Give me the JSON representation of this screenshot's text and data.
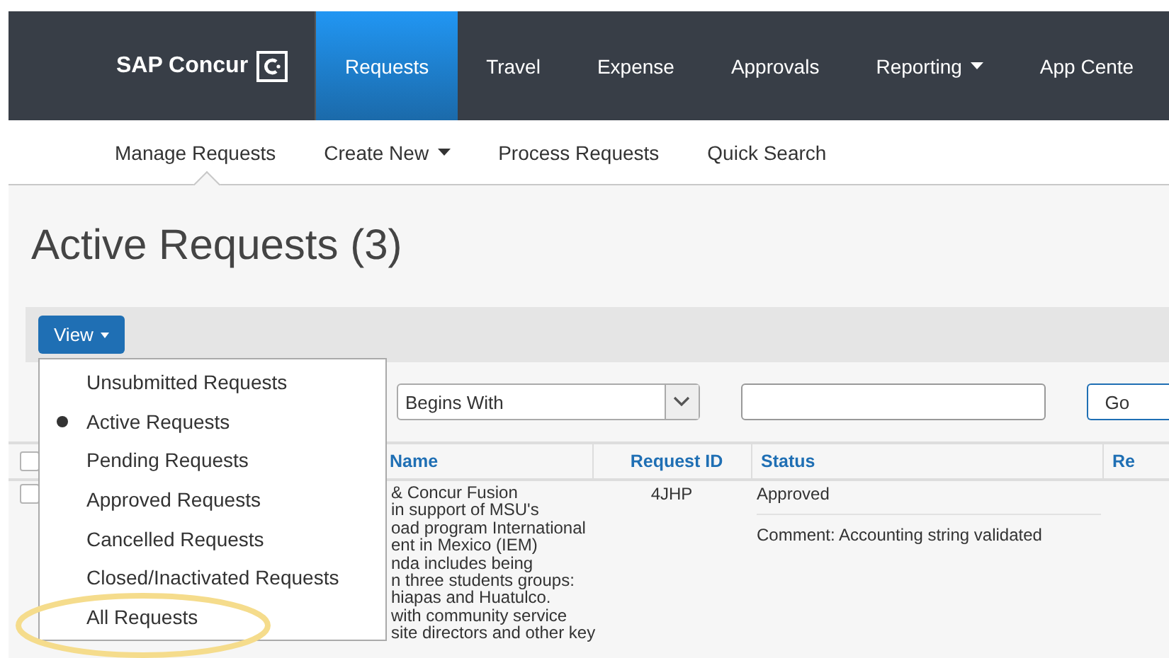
{
  "nav": {
    "logo": "SAP Concur",
    "items": [
      {
        "label": "Requests",
        "selected": true,
        "dropdown": false
      },
      {
        "label": "Travel",
        "selected": false,
        "dropdown": false
      },
      {
        "label": "Expense",
        "selected": false,
        "dropdown": false
      },
      {
        "label": "Approvals",
        "selected": false,
        "dropdown": false
      },
      {
        "label": "Reporting",
        "selected": false,
        "dropdown": true
      },
      {
        "label": "App Cente",
        "selected": false,
        "dropdown": false
      }
    ]
  },
  "subnav": {
    "items": [
      {
        "label": "Manage Requests",
        "selected": true,
        "dropdown": false
      },
      {
        "label": "Create New",
        "selected": false,
        "dropdown": true
      },
      {
        "label": "Process Requests",
        "selected": false,
        "dropdown": false
      },
      {
        "label": "Quick Search",
        "selected": false,
        "dropdown": false
      }
    ]
  },
  "page_title": "Active Requests (3)",
  "view_button": "View",
  "view_menu": [
    {
      "label": "Unsubmitted Requests",
      "selected": false,
      "highlighted": false
    },
    {
      "label": "Active Requests",
      "selected": true,
      "highlighted": false
    },
    {
      "label": "Pending Requests",
      "selected": false,
      "highlighted": false
    },
    {
      "label": "Approved Requests",
      "selected": false,
      "highlighted": false
    },
    {
      "label": "Cancelled Requests",
      "selected": false,
      "highlighted": false
    },
    {
      "label": "Closed/Inactivated Requests",
      "selected": false,
      "highlighted": false
    },
    {
      "label": "All Requests",
      "selected": false,
      "highlighted": true
    }
  ],
  "filter": {
    "operator": "Begins With",
    "go": "Go"
  },
  "table": {
    "columns": [
      "Name",
      "Request ID",
      "Status",
      "Re"
    ],
    "select_all_checked": false,
    "rows": [
      {
        "checked": false,
        "name_lines": [
          "& Concur Fusion",
          "in support of MSU's",
          "oad program International",
          "ent in Mexico (IEM)",
          "nda includes being",
          "n three students groups:",
          "hiapas and Huatulco.",
          "with community service",
          "site directors and other key"
        ],
        "request_id": "4JHP",
        "status": "Approved",
        "comment": "Comment: Accounting string validated"
      }
    ]
  }
}
